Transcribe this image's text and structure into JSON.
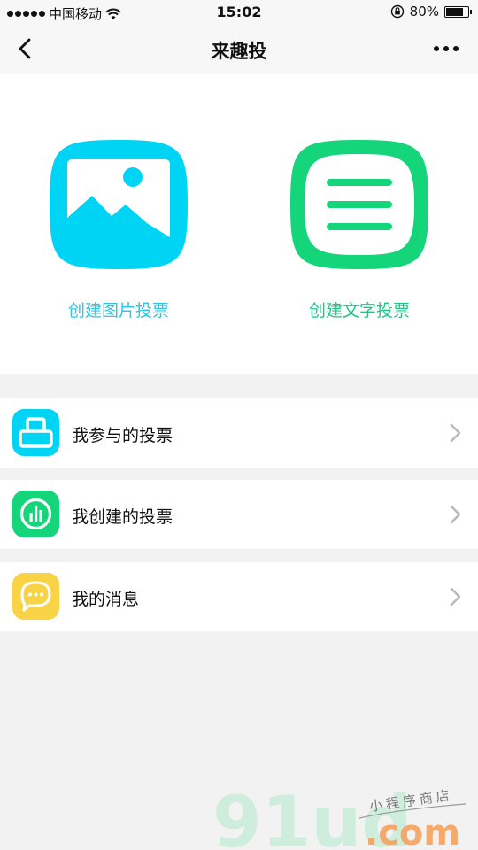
{
  "status_bar": {
    "carrier": "中国移动",
    "time": "15:02",
    "battery": "80%",
    "battery_level": 0.8
  },
  "nav": {
    "title": "来趣投",
    "back_icon": "chevron-left-icon",
    "more_icon": "more-dots-icon"
  },
  "hero": {
    "image_vote": {
      "label": "创建图片投票",
      "icon": "image-icon",
      "color": "#00d4f5"
    },
    "text_vote": {
      "label": "创建文字投票",
      "icon": "menu-lines-icon",
      "color": "#14d57a"
    }
  },
  "menu": {
    "items": [
      {
        "label": "我参与的投票",
        "icon": "ballot-box-icon",
        "color": "#00d4f5"
      },
      {
        "label": "我创建的投票",
        "icon": "bar-chart-icon",
        "color": "#14d57a"
      },
      {
        "label": "我的消息",
        "icon": "chat-bubble-icon",
        "color": "#f7d345"
      }
    ]
  },
  "watermark": {
    "brand": "91ud",
    "domain": ".com",
    "tagline": "小程序商店"
  }
}
